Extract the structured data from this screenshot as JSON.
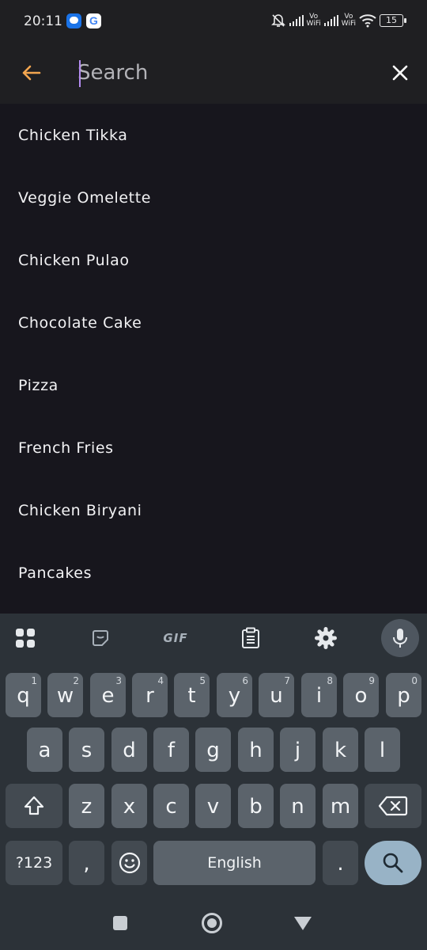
{
  "status_bar": {
    "time": "20:11",
    "google_letter": "G",
    "vowifi_1": "Vo\nWiFi",
    "vowifi_2": "Vo\nWiFi",
    "battery": "15"
  },
  "search": {
    "placeholder": "Search",
    "value": ""
  },
  "results": [
    "Chicken Tikka",
    "Veggie Omelette",
    "Chicken Pulao",
    "Chocolate Cake",
    "Pizza",
    "French Fries",
    "Chicken Biryani",
    "Pancakes"
  ],
  "keyboard": {
    "toolbar": {
      "gif": "GIF"
    },
    "row1": [
      {
        "key": "q",
        "hint": "1"
      },
      {
        "key": "w",
        "hint": "2"
      },
      {
        "key": "e",
        "hint": "3"
      },
      {
        "key": "r",
        "hint": "4"
      },
      {
        "key": "t",
        "hint": "5"
      },
      {
        "key": "y",
        "hint": "6"
      },
      {
        "key": "u",
        "hint": "7"
      },
      {
        "key": "i",
        "hint": "8"
      },
      {
        "key": "o",
        "hint": "9"
      },
      {
        "key": "p",
        "hint": "0"
      }
    ],
    "row2": [
      "a",
      "s",
      "d",
      "f",
      "g",
      "h",
      "j",
      "k",
      "l"
    ],
    "row3": [
      "z",
      "x",
      "c",
      "v",
      "b",
      "n",
      "m"
    ],
    "symbols_label": "?123",
    "comma": ",",
    "space_label": "English",
    "period": "."
  },
  "colors": {
    "accent_back_arrow": "#f3a64f",
    "caret": "#b48cf0",
    "search_key": "#98b3c6"
  }
}
